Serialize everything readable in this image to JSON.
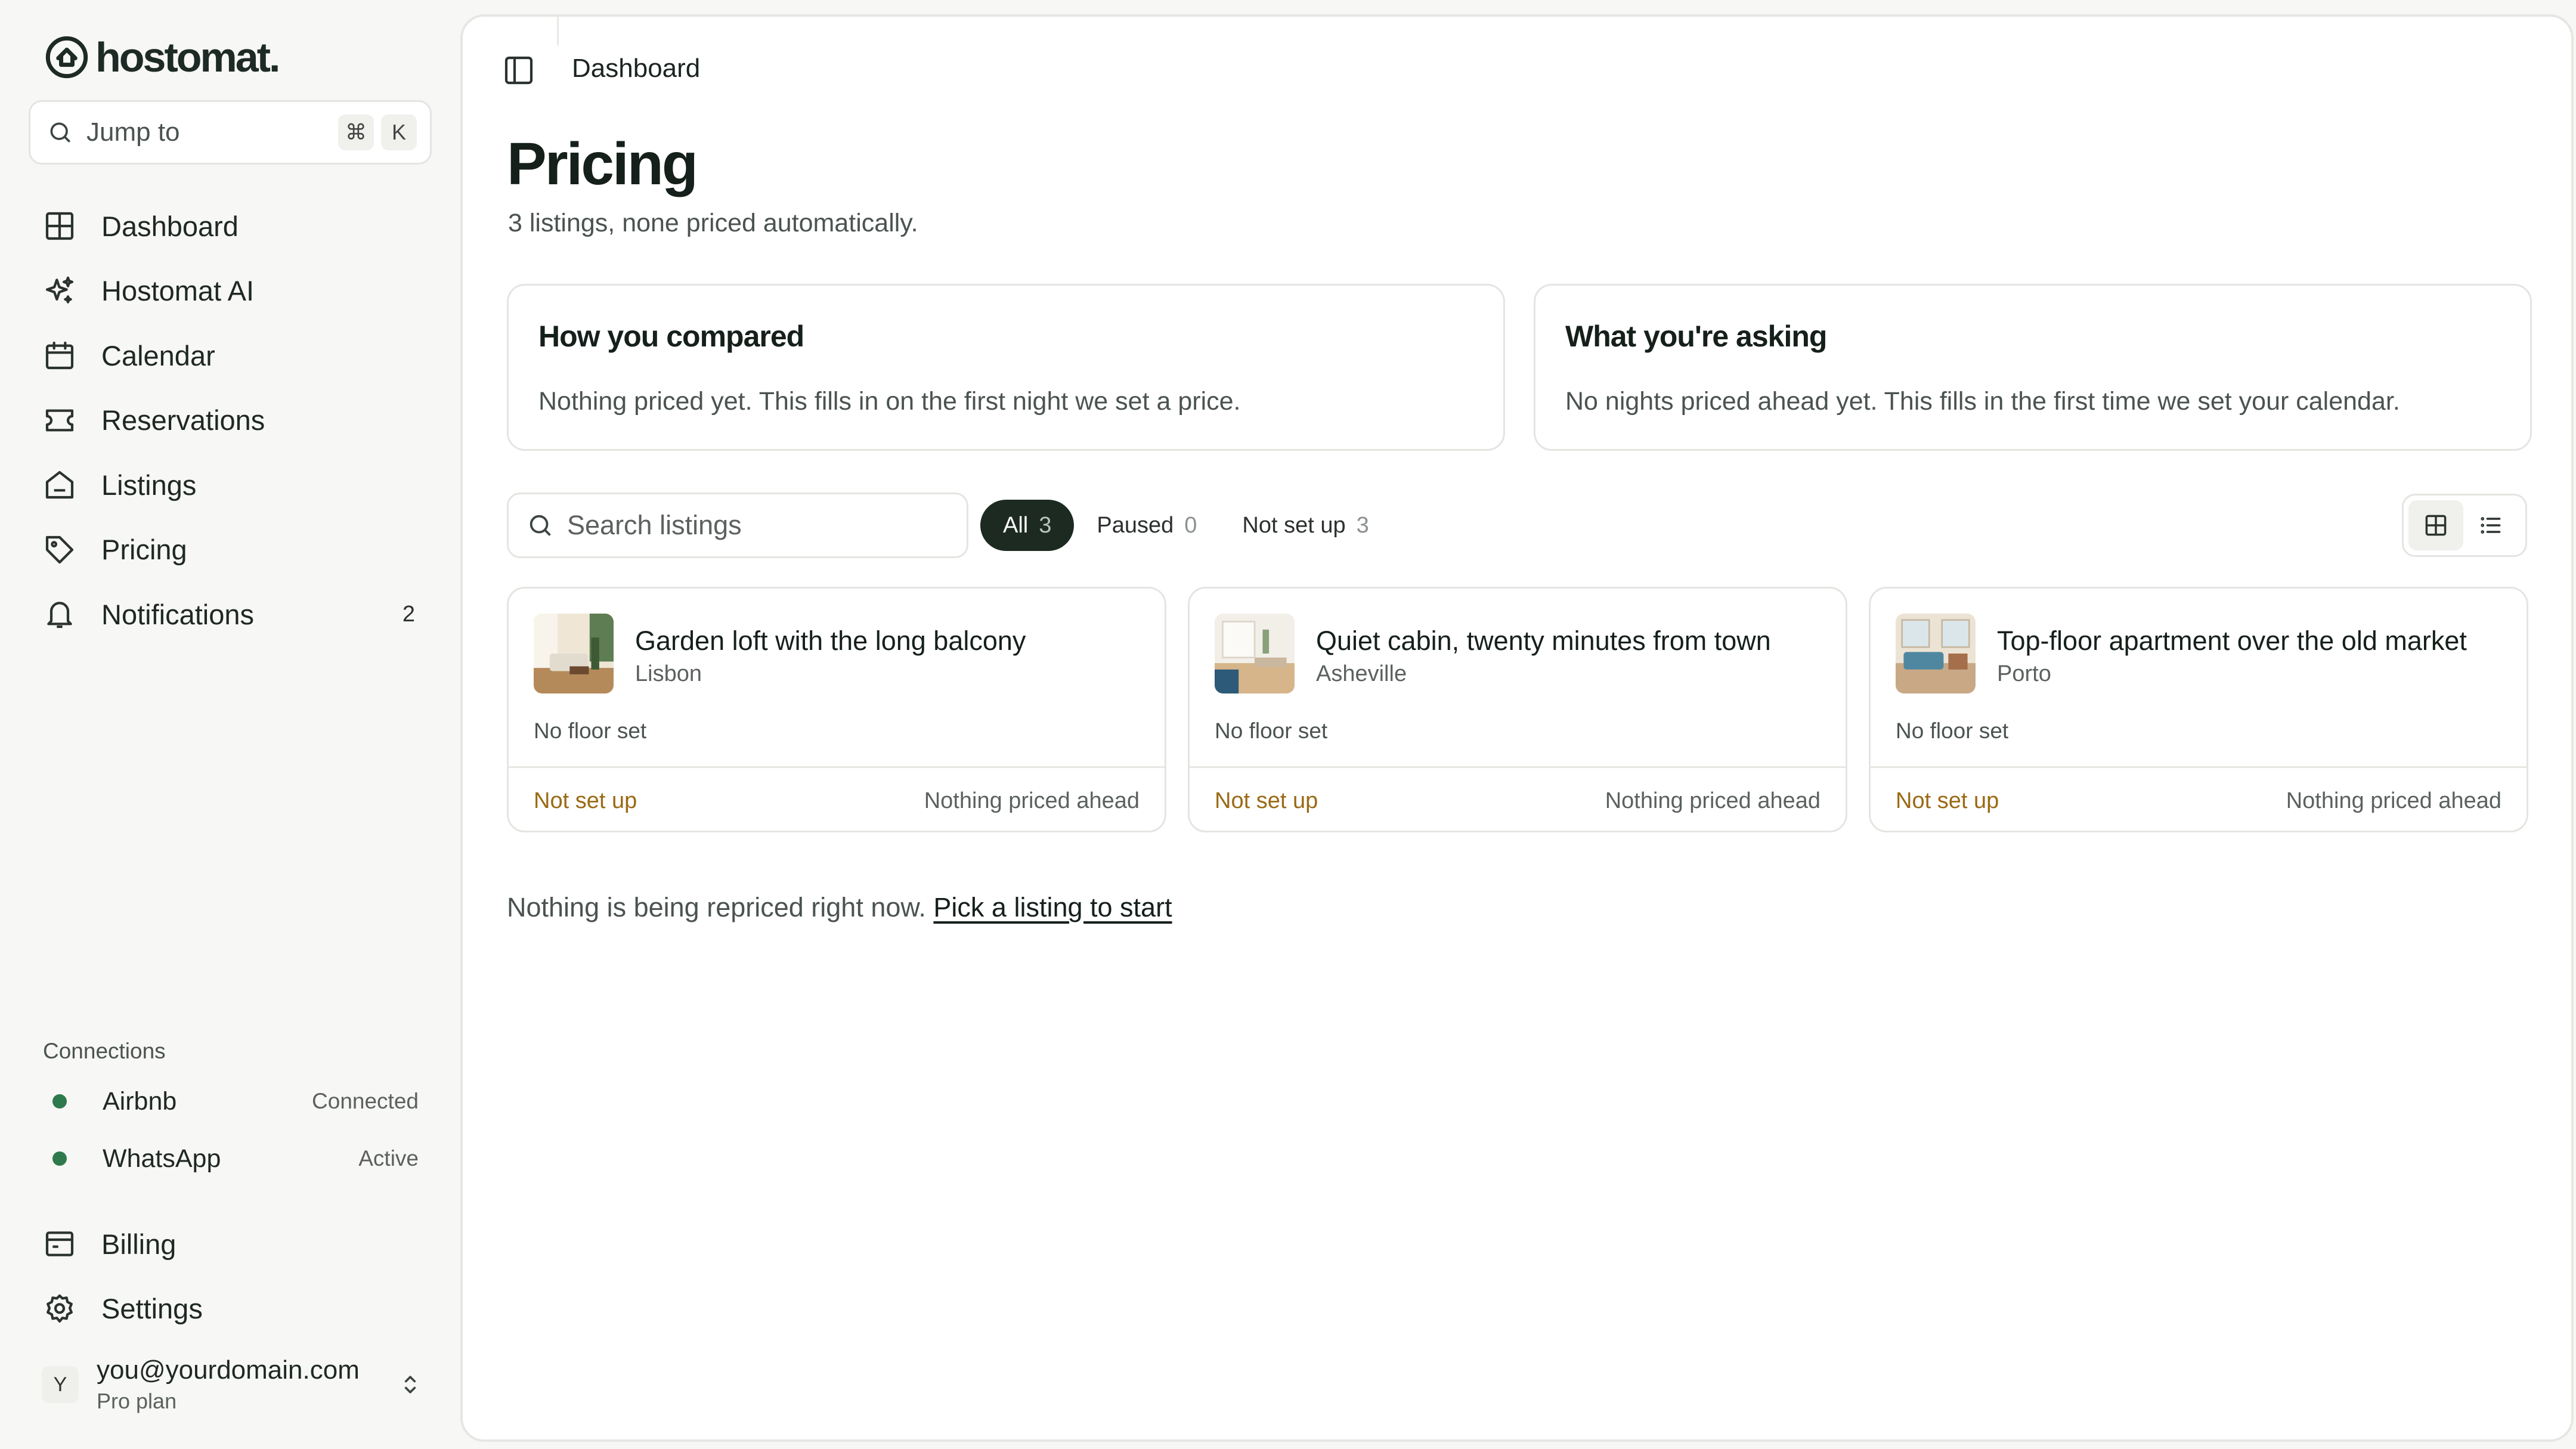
{
  "brand": {
    "name": "hostomat."
  },
  "jump": {
    "label": "Jump to",
    "key1": "⌘",
    "key2": "K"
  },
  "sidebar": {
    "items": [
      {
        "label": "Dashboard"
      },
      {
        "label": "Hostomat AI"
      },
      {
        "label": "Calendar"
      },
      {
        "label": "Reservations"
      },
      {
        "label": "Listings"
      },
      {
        "label": "Pricing"
      },
      {
        "label": "Notifications",
        "count": "2"
      }
    ],
    "connections_title": "Connections",
    "connections": [
      {
        "name": "Airbnb",
        "status": "Connected"
      },
      {
        "name": "WhatsApp",
        "status": "Active"
      }
    ],
    "bottom_items": [
      {
        "label": "Billing"
      },
      {
        "label": "Settings"
      }
    ],
    "user": {
      "initial": "Y",
      "email": "you@yourdomain.com",
      "plan": "Pro plan"
    }
  },
  "topbar": {
    "title": "Dashboard"
  },
  "page": {
    "title": "Pricing",
    "subtitle": "3 listings, none priced automatically."
  },
  "cards": [
    {
      "title": "How you compared",
      "text": "Nothing priced yet. This fills in on the first night we set a price."
    },
    {
      "title": "What you're asking",
      "text": "No nights priced ahead yet. This fills in the first time we set your calendar."
    }
  ],
  "search": {
    "placeholder": "Search listings"
  },
  "filters": [
    {
      "label": "All",
      "count": "3"
    },
    {
      "label": "Paused",
      "count": "0"
    },
    {
      "label": "Not set up",
      "count": "3"
    }
  ],
  "listings": [
    {
      "title": "Garden loft with the long balcony",
      "city": "Lisbon",
      "floor": "No floor set",
      "status": "Not set up",
      "ahead": "Nothing priced ahead"
    },
    {
      "title": "Quiet cabin, twenty minutes from town",
      "city": "Asheville",
      "floor": "No floor set",
      "status": "Not set up",
      "ahead": "Nothing priced ahead"
    },
    {
      "title": "Top-floor apartment over the old market",
      "city": "Porto",
      "floor": "No floor set",
      "status": "Not set up",
      "ahead": "Nothing priced ahead"
    }
  ],
  "footer": {
    "text": "Nothing is being repriced right now.",
    "link": "Pick a listing to start"
  },
  "colors": {
    "accent_dark": "#1c2a22",
    "status_warning": "#9a6a14",
    "connected_dot": "#2e7a4c"
  }
}
